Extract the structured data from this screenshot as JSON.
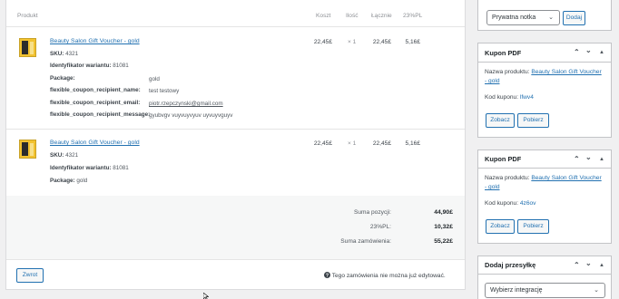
{
  "headers": {
    "product": "Produkt",
    "cost": "Koszt",
    "qty": "Ilość",
    "total": "Łącznie",
    "tax": "23%PL"
  },
  "items": [
    {
      "name": "Beauty Salon Gift Voucher - gold",
      "sku_label": "SKU:",
      "sku": "4321",
      "variant_label": "Identyfikator wariantu:",
      "variant": "81081",
      "package_label": "Package:",
      "package": "gold",
      "recipient_name_label": "flexible_coupon_recipient_name:",
      "recipient_name": "test testowy",
      "recipient_email_label": "flexible_coupon_recipient_email:",
      "recipient_email": "piotr.rzepczynski@gmail.com",
      "recipient_message_label": "flexible_coupon_recipient_message:",
      "recipient_message": "gyubvgv vuyvuyvyuv uyvuyvguyv",
      "cost": "22,45£",
      "qty": "× 1",
      "total": "22,45£",
      "tax": "5,16£"
    },
    {
      "name": "Beauty Salon Gift Voucher - gold",
      "sku_label": "SKU:",
      "sku": "4321",
      "variant_label": "Identyfikator wariantu:",
      "variant": "81081",
      "package_label": "Package:",
      "package": "gold",
      "cost": "22,45£",
      "qty": "× 1",
      "total": "22,45£",
      "tax": "5,16£"
    }
  ],
  "totals": [
    {
      "label": "Suma pozycji:",
      "value": "44,90£"
    },
    {
      "label": "23%PL:",
      "value": "10,32£"
    },
    {
      "label": "Suma zamówienia:",
      "value": "55,22£"
    }
  ],
  "refund_button": "Zwrot",
  "not_editable_note": "Tego zamówienia nie można już edytować.",
  "notes": {
    "select_value": "Prywatna notka",
    "add_button": "Dodaj"
  },
  "coupon_boxes": [
    {
      "title": "Kupon PDF",
      "product_label": "Nazwa produktu:",
      "product": "Beauty Salon Gift Voucher - gold",
      "code_label": "Kod kuponu:",
      "code": "lfwv4",
      "view_button": "Zobacz",
      "download_button": "Pobierz"
    },
    {
      "title": "Kupon PDF",
      "product_label": "Nazwa produktu:",
      "product": "Beauty Salon Gift Voucher - gold",
      "code_label": "Kod kuponu:",
      "code": "4z6ov",
      "view_button": "Zobacz",
      "download_button": "Pobierz"
    }
  ],
  "shipment": {
    "title": "Dodaj przesyłkę",
    "select_placeholder": "Wybierz integrację"
  },
  "icons": {
    "up": "chevron-up-icon",
    "down": "chevron-down-icon",
    "toggle": "triangle-toggle-icon",
    "help": "question-circle-icon"
  }
}
